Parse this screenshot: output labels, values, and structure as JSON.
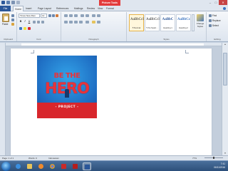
{
  "titlebar": {
    "context_tab": "Picture Tools",
    "window_buttons": [
      "–",
      "□",
      "✕"
    ]
  },
  "tabs": {
    "file": "File",
    "items": [
      "Home",
      "Insert",
      "Page Layout",
      "References",
      "Mailings",
      "Review",
      "View",
      "Format"
    ],
    "active": "Home"
  },
  "ribbon": {
    "clipboard": {
      "paste": "Paste",
      "label": "Clipboard"
    },
    "font": {
      "name": "Times New Rom",
      "size": "12",
      "bold": "B",
      "italic": "I",
      "underline": "U",
      "label": "Font"
    },
    "paragraph": {
      "label": "Paragraph"
    },
    "styles": {
      "items": [
        {
          "sample": "AaBbCcI",
          "name": "¶ Normal"
        },
        {
          "sample": "AaBbCcI",
          "name": "¶ No Spaci..."
        },
        {
          "sample": "AaBbC",
          "name": "Heading 1"
        },
        {
          "sample": "AaBbCc",
          "name": "Heading 2"
        }
      ],
      "change_styles": "Change Styles",
      "label": "Styles"
    },
    "editing": {
      "find": "Find",
      "replace": "Replace",
      "select": "Select",
      "label": "Editing"
    }
  },
  "poster": {
    "line1": "BE THE",
    "line2": "HERO",
    "line3": "- PROJECT -"
  },
  "statusbar": {
    "page": "Page: 1 of 1",
    "words": "Words: 0",
    "language": "Indonesian",
    "zoom": "77%"
  },
  "taskbar": {
    "time": "7:41",
    "date": "06/11/2016"
  },
  "colors": {
    "file_tab": "#2a5699",
    "context_tab": "#e33b3b",
    "poster_blue": "#1f6fc4",
    "poster_red": "#d8262c"
  }
}
